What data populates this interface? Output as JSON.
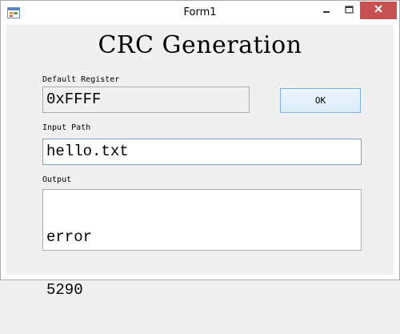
{
  "window": {
    "title": "Form1"
  },
  "header": {
    "title": "CRC Generation"
  },
  "register": {
    "label": "Default Register",
    "value": "0xFFFF"
  },
  "actions": {
    "ok_label": "OK"
  },
  "input_path": {
    "label": "Input Path",
    "value": "hello.txt"
  },
  "output": {
    "label": "Output",
    "lines": [
      "error",
      "5290"
    ]
  },
  "colors": {
    "close_button": "#c75050",
    "button_border": "#7eb4ea",
    "focus_border": "#7da2ce"
  }
}
